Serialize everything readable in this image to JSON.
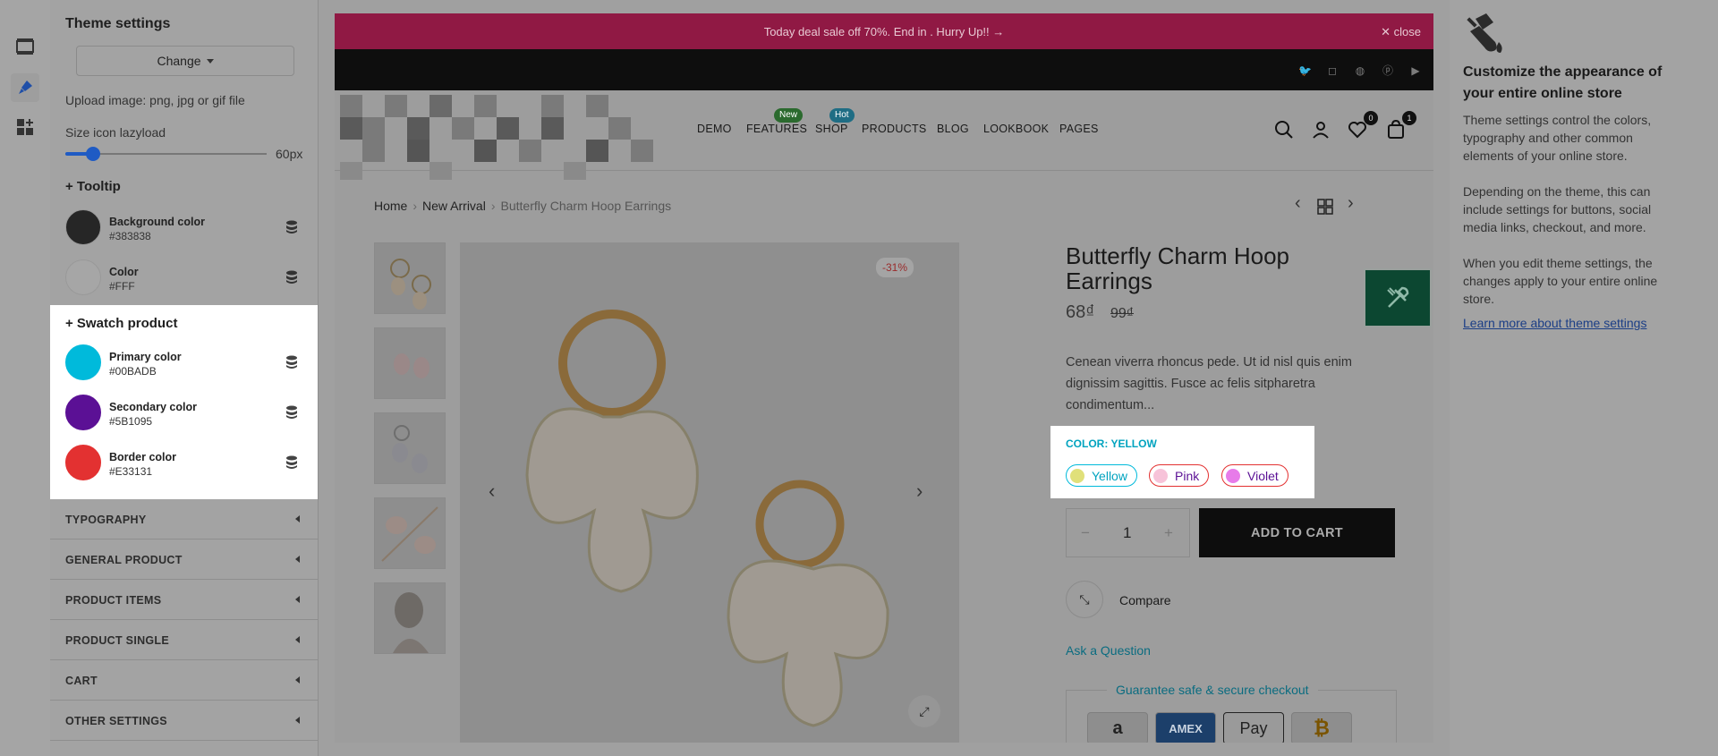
{
  "panel": {
    "title": "Theme settings",
    "change_label": "Change",
    "upload_hint": "Upload image: png, jpg or gif file",
    "size_label": "Size icon lazyload",
    "size_value": "60px",
    "size_fraction": 0.12,
    "tooltip_heading": "+ Tooltip",
    "tooltip_colors": [
      {
        "name": "Background color",
        "hex": "#383838"
      },
      {
        "name": "Color",
        "hex": "#FFF"
      }
    ],
    "swatch_heading": "+ Swatch product",
    "swatch_colors": [
      {
        "name": "Primary color",
        "hex": "#00BADB"
      },
      {
        "name": "Secondary color",
        "hex": "#5B1095"
      },
      {
        "name": "Border color",
        "hex": "#E33131"
      }
    ],
    "sections": [
      "TYPOGRAPHY",
      "GENERAL PRODUCT",
      "PRODUCT ITEMS",
      "PRODUCT SINGLE",
      "CART",
      "OTHER SETTINGS"
    ]
  },
  "store": {
    "promo": "Today deal sale off 70%. End in . Hurry Up!! →",
    "promo_close": "✕ close",
    "social": [
      "twitter-icon",
      "instagram-icon",
      "dribbble-icon",
      "pinterest-icon",
      "youtube-icon"
    ],
    "nav": [
      "DEMO",
      "FEATURES",
      "SHOP",
      "PRODUCTS",
      "BLOG",
      "LOOKBOOK",
      "PAGES"
    ],
    "badges": {
      "features": "New",
      "shop": "Hot"
    },
    "wishlist_count": "0",
    "cart_count": "1",
    "breadcrumb": [
      "Home",
      "New Arrival",
      "Butterfly Charm Hoop Earrings"
    ],
    "discount": "-31%",
    "title": "Butterfly Charm Hoop Earrings",
    "price": "68₫",
    "old_price": "99₫",
    "description": "Cenean viverra rhoncus pede. Ut id nisl quis enim dignissim sagittis. Fusce ac felis sitpharetra condimentum...",
    "color_label": "COLOR: YELLOW",
    "variants": [
      {
        "label": "Yellow",
        "dot": "#e0e07a",
        "border": "#00BADB"
      },
      {
        "label": "Pink",
        "dot": "#f7c3d9",
        "border": "#E33131"
      },
      {
        "label": "Violet",
        "dot": "#e77be9",
        "border": "#E33131"
      }
    ],
    "qty_minus": "−",
    "qty": "1",
    "qty_plus": "+",
    "add_to_cart": "ADD TO CART",
    "compare": "Compare",
    "ask": "Ask a Question",
    "guarantee": "Guarantee safe & secure checkout",
    "payments": [
      "a",
      "AMEX",
      "Pay",
      "₿"
    ]
  },
  "info": {
    "heading": "Customize the appearance of your entire online store",
    "p1": "Theme settings control the colors, typography and other common elements of your online store.",
    "p2": "Depending on the theme, this can include settings for buttons, social media links, checkout, and more.",
    "p3": "When you edit theme settings, the changes apply to your entire online store.",
    "link": "Learn more about theme settings"
  }
}
